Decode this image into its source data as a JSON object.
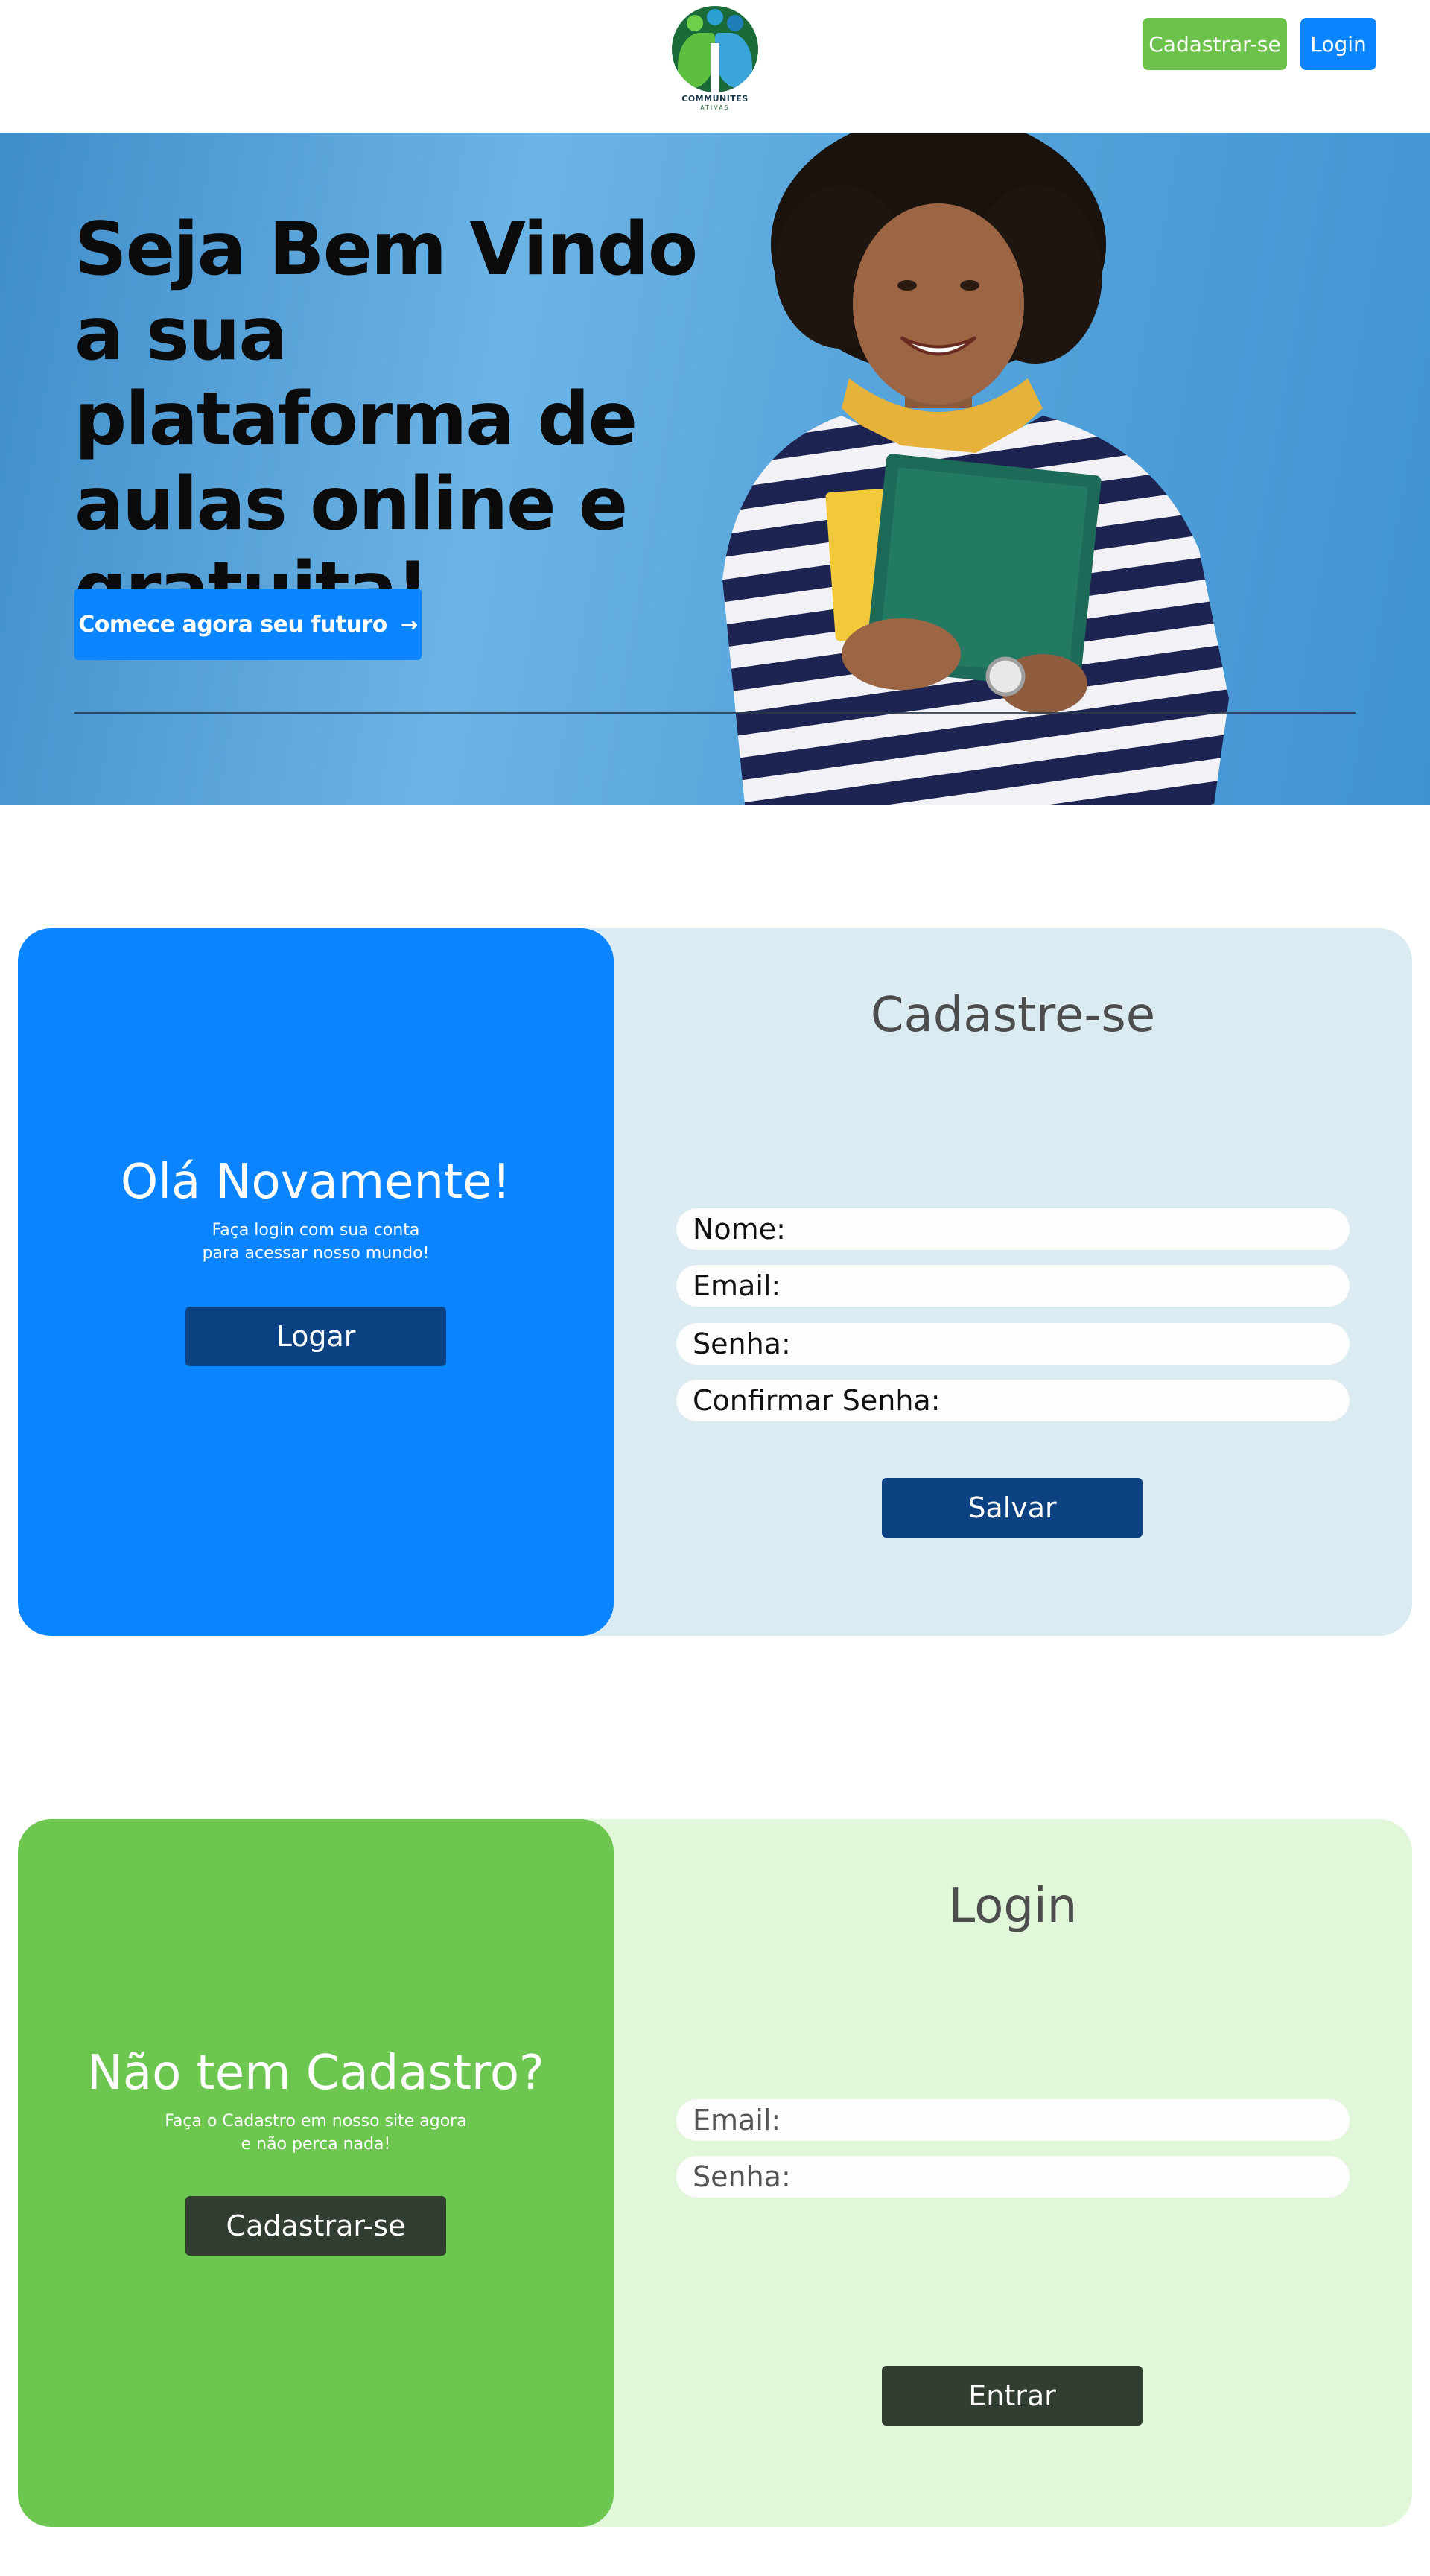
{
  "header": {
    "logo_text": "COMMUNITES",
    "logo_sub": "ATIVAS",
    "signup_label": "Cadastrar-se",
    "login_label": "Login",
    "colors": {
      "signup": "#6cc24a",
      "login": "#0a84ff"
    }
  },
  "hero": {
    "title": "Seja Bem Vindo a sua plataforma de aulas online e gratuita!",
    "cta_label": "Comece agora seu futuro",
    "cta_icon": "arrow-right-icon"
  },
  "register_panel": {
    "side_title": "Olá Novamente!",
    "side_sub_line1": "Faça login com sua conta",
    "side_sub_line2": "para acessar nosso mundo!",
    "side_button": "Logar",
    "form_title": "Cadastre-se",
    "fields": [
      {
        "label": "Nome:"
      },
      {
        "label": "Email:"
      },
      {
        "label": "Senha:"
      },
      {
        "label": "Confirmar Senha:"
      }
    ],
    "submit": "Salvar",
    "colors": {
      "side": "#0a84ff",
      "form_bg": "#daebf2",
      "button": "#0d4282"
    }
  },
  "login_panel": {
    "side_title": "Não tem Cadastro?",
    "side_sub_line1": "Faça o Cadastro em nosso site agora",
    "side_sub_line2": "e não perca nada!",
    "side_button": "Cadastrar-se",
    "form_title": "Login",
    "fields": [
      {
        "label": "Email:"
      },
      {
        "label": "Senha:"
      }
    ],
    "submit": "Entrar",
    "colors": {
      "side": "#6cc64f",
      "form_bg": "#e1f7da",
      "button": "#333e33"
    }
  }
}
